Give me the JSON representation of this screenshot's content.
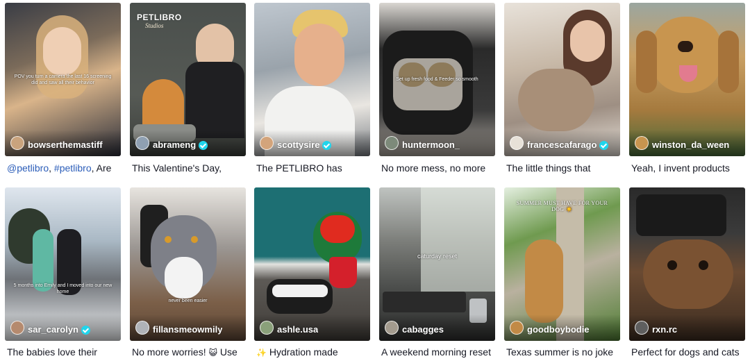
{
  "videos": [
    {
      "handle": "bowserthemastiff",
      "verified": false,
      "overlay": "POV you turn a camera the last 16 screening did and saw all their behavior",
      "caption_parts": [
        {
          "text": "@petlibro",
          "link": true
        },
        {
          "text": ", ",
          "link": false
        },
        {
          "text": "#petlibro",
          "link": true
        },
        {
          "text": ", Are",
          "link": false
        }
      ]
    },
    {
      "handle": "abrameng",
      "verified": true,
      "brand": "PETLIBRO",
      "brand_sub": "Studios",
      "caption_parts": [
        {
          "text": "This Valentine's Day,",
          "link": false
        }
      ]
    },
    {
      "handle": "scottysire",
      "verified": true,
      "caption_parts": [
        {
          "text": "The PETLIBRO has",
          "link": false
        }
      ]
    },
    {
      "handle": "huntermoon_",
      "verified": false,
      "overlay": "Set up fresh food & Feeder so smooth",
      "caption_parts": [
        {
          "text": "No more mess, no more",
          "link": false
        }
      ]
    },
    {
      "handle": "francescafarago",
      "verified": true,
      "caption_parts": [
        {
          "text": "The little things that",
          "link": false
        }
      ]
    },
    {
      "handle": "winston_da_ween",
      "verified": false,
      "caption_parts": [
        {
          "text": "Yeah, I invent products",
          "link": false
        }
      ]
    },
    {
      "handle": "sar_carolyn",
      "verified": true,
      "overlay": "5 months into Emily and I moved into our new home",
      "caption_parts": [
        {
          "text": "The babies love their",
          "link": false
        }
      ]
    },
    {
      "handle": "fillansmeowmily",
      "verified": false,
      "overlay": "never been easier",
      "caption_parts": [
        {
          "text": "No more worries! ",
          "link": false
        },
        {
          "text": "😺",
          "link": false,
          "emoji": true
        },
        {
          "text": " Use",
          "link": false
        }
      ]
    },
    {
      "handle": "ashle.usa",
      "verified": false,
      "caption_parts": [
        {
          "text": "✨",
          "link": false,
          "emoji": true
        },
        {
          "text": " Hydration made",
          "link": false
        }
      ]
    },
    {
      "handle": "cabagges",
      "verified": false,
      "overlay": "caturday reset",
      "caption_parts": [
        {
          "text": "A weekend morning reset",
          "link": false
        }
      ]
    },
    {
      "handle": "goodboybodie",
      "verified": false,
      "overlay": "SUMMER MUST HAVE FOR YOUR DOG ☀️",
      "caption_parts": [
        {
          "text": "Texas summer is no joke",
          "link": false
        }
      ]
    },
    {
      "handle": "rxn.rc",
      "verified": false,
      "caption_parts": [
        {
          "text": "Perfect for dogs and cats",
          "link": false
        }
      ]
    }
  ],
  "colors": {
    "verified_badge": "#20d5ec",
    "link": "#2b5db9",
    "text": "#161823"
  }
}
